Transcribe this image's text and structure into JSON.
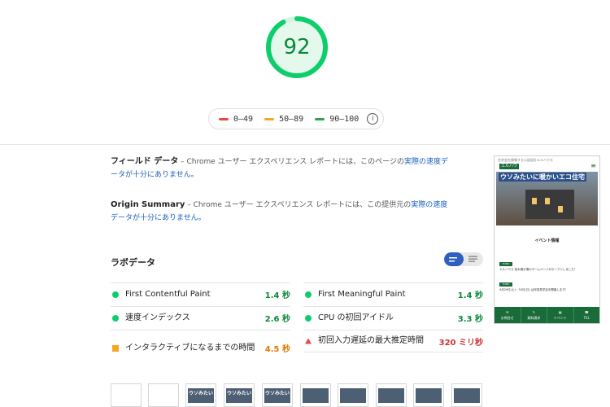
{
  "score": {
    "value": "92",
    "fraction": 0.92,
    "color": "#0cce6b"
  },
  "legend": [
    {
      "label": "0–49",
      "color": "#e34c42"
    },
    {
      "label": "50–89",
      "color": "#f5a623"
    },
    {
      "label": "90–100",
      "color": "#2ea44f"
    }
  ],
  "legend_info": "i",
  "field_data": {
    "title": "フィールド データ",
    "text_pre": " – Chrome ユーザー エクスペリエンス レポートには、このページの",
    "link": "実際の速度データが十分にありません。"
  },
  "origin_summary": {
    "title": "Origin Summary",
    "text_pre": " – Chrome ユーザー エクスペリエンス レポートには、この提供元の",
    "link": "実際の速度データが十分にありません。"
  },
  "lab": {
    "title": "ラボデータ",
    "metrics_left": [
      {
        "label": "First Contentful Paint",
        "value": "1.4 秒",
        "status": "pass",
        "color": "#0a8a3a"
      },
      {
        "label": "速度インデックス",
        "value": "2.6 秒",
        "status": "pass",
        "color": "#0a8a3a"
      },
      {
        "label": "インタラクティブになるまでの時間",
        "value": "4.5 秒",
        "status": "average",
        "color": "#e67700"
      }
    ],
    "metrics_right": [
      {
        "label": "First Meaningful Paint",
        "value": "1.4 秒",
        "status": "pass",
        "color": "#0a8a3a"
      },
      {
        "label": "CPU の初回アイドル",
        "value": "3.3 秒",
        "status": "pass",
        "color": "#0a8a3a"
      },
      {
        "label": "初回入力遅延の最大推定時間",
        "value": "320 ミリ秒",
        "status": "fail",
        "color": "#d32f2f"
      }
    ]
  },
  "preview": {
    "top_text": "住宅会社情報する公認設計エルハウス",
    "logo": "エルハウス",
    "banner_title": "ウソみたいに暖かいエコ住宅",
    "section_title": "イベント情報",
    "tag": "TOPIC",
    "news1": "エルハウス 桜木展示場のホームページがオープンしました！",
    "news2": "9月29日(土)・30日(日) は完成見学会を開催します！",
    "nav": [
      "お問合せ",
      "資料請求",
      "イベント",
      "TEL"
    ],
    "thumb_text": "ウソみたい"
  }
}
